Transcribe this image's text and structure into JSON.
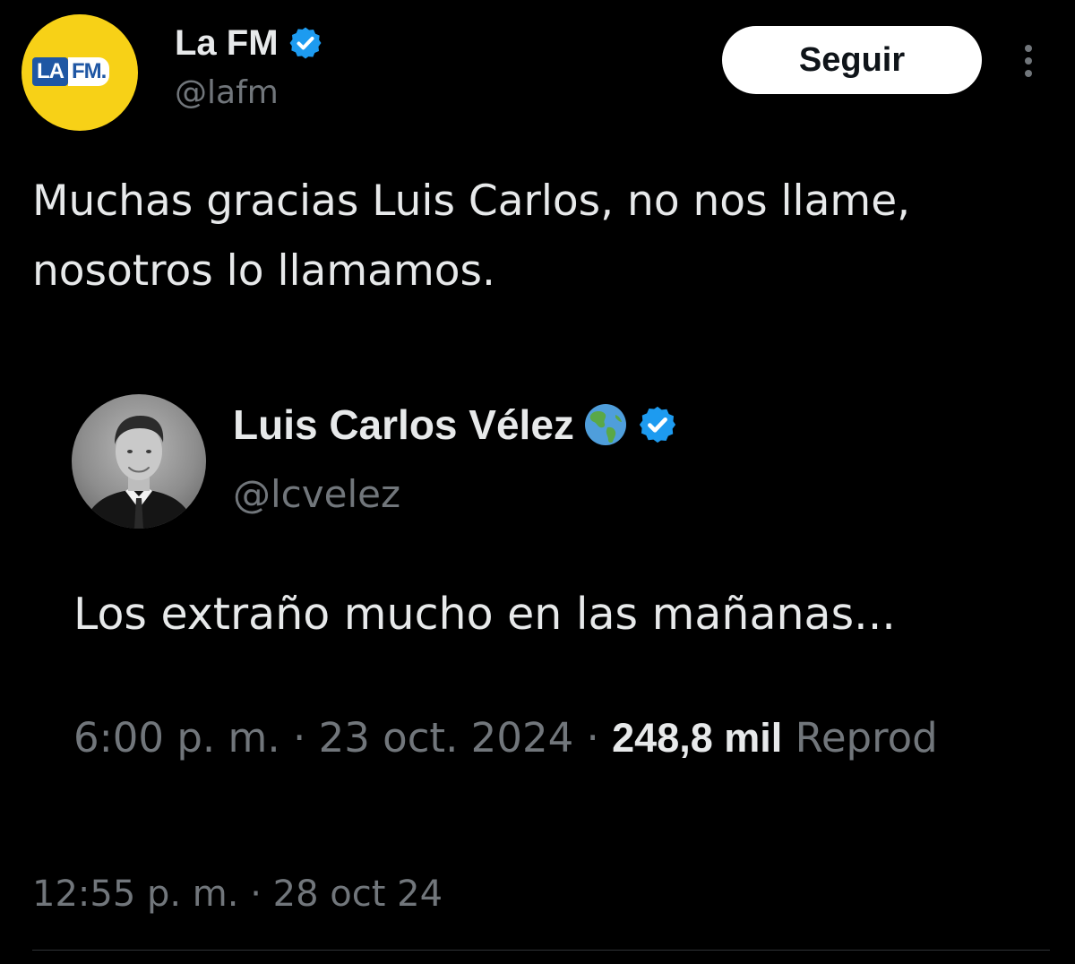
{
  "account": {
    "name": "La FM",
    "handle": "@lafm",
    "verified_icon": "verified-badge-icon",
    "logo": {
      "part1": "LA",
      "part2": "FM."
    }
  },
  "follow_label": "Seguir",
  "more_icon": "more-vertical-icon",
  "tweet": {
    "line1": "Muchas gracias Luis Carlos, no nos llame,",
    "line2": "nosotros lo llamamos."
  },
  "quoted": {
    "name": "Luis Carlos Vélez",
    "emoji": "🌎",
    "handle": "@lcvelez",
    "text": "Los extraño mucho en las mañanas...",
    "time": "6:00 p. m.",
    "date": "23 oct. 2024",
    "views": "248,8 mil",
    "views_label": "Reprod"
  },
  "post": {
    "time": "12:55 p. m.",
    "date": "28 oct 24"
  },
  "separator": " · ",
  "colors": {
    "background": "#000000",
    "text": "#e7e9ea",
    "muted": "#71767b",
    "verified": "#1d9bf0",
    "lafm_yellow": "#f7d117",
    "lafm_blue": "#1f57a4"
  }
}
